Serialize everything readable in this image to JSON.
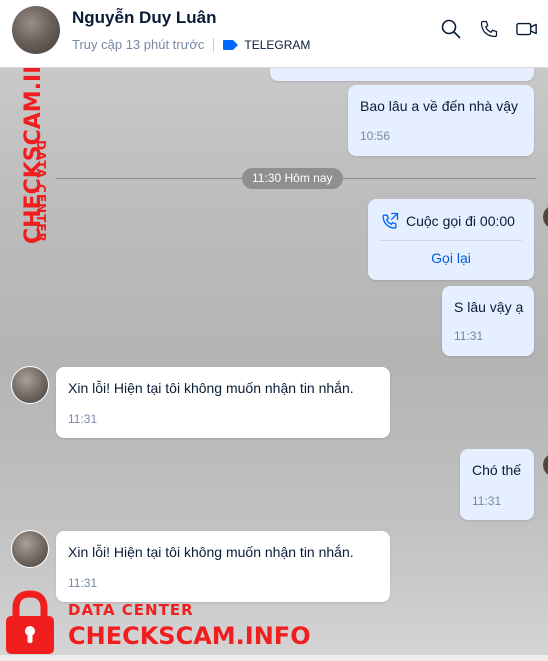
{
  "header": {
    "contact_name": "Nguyễn Duy Luân",
    "last_seen": "Truy cập 13 phút trước",
    "tag": "TELEGRAM",
    "tag_color": "#0068ff"
  },
  "messages": [
    {
      "from": "me",
      "text": "Bao lâu a về đến nhà vậy",
      "time": "10:56"
    },
    {
      "type": "separator",
      "text": "11:30 Hôm nay"
    },
    {
      "from": "me",
      "type": "call",
      "text": "Cuộc gọi đi 00:00",
      "action": "Gọi lại"
    },
    {
      "from": "me",
      "text": "S lâu vậy ạ",
      "time": "11:31"
    },
    {
      "from": "contact",
      "text": "Xin lỗi! Hiện tại tôi không muốn nhận tin nhắn.",
      "time": "11:31"
    },
    {
      "from": "me",
      "text": "Chó thế",
      "time": "11:31"
    },
    {
      "from": "contact",
      "text": "Xin lỗi! Hiện tại tôi không muốn nhận tin nhắn.",
      "time": "11:31"
    }
  ],
  "watermark": {
    "vertical_big": "CHECKSCAM.INFO",
    "vertical_small": "DATA CENTER",
    "bottom_small": "DATA CENTER",
    "bottom_big": "CHECKSCAM.INFO",
    "color": "#f01e1e"
  },
  "icons": [
    "search-icon",
    "phone-icon",
    "video-call-icon",
    "tag-icon",
    "phone-outgoing-icon",
    "lock-icon"
  ]
}
